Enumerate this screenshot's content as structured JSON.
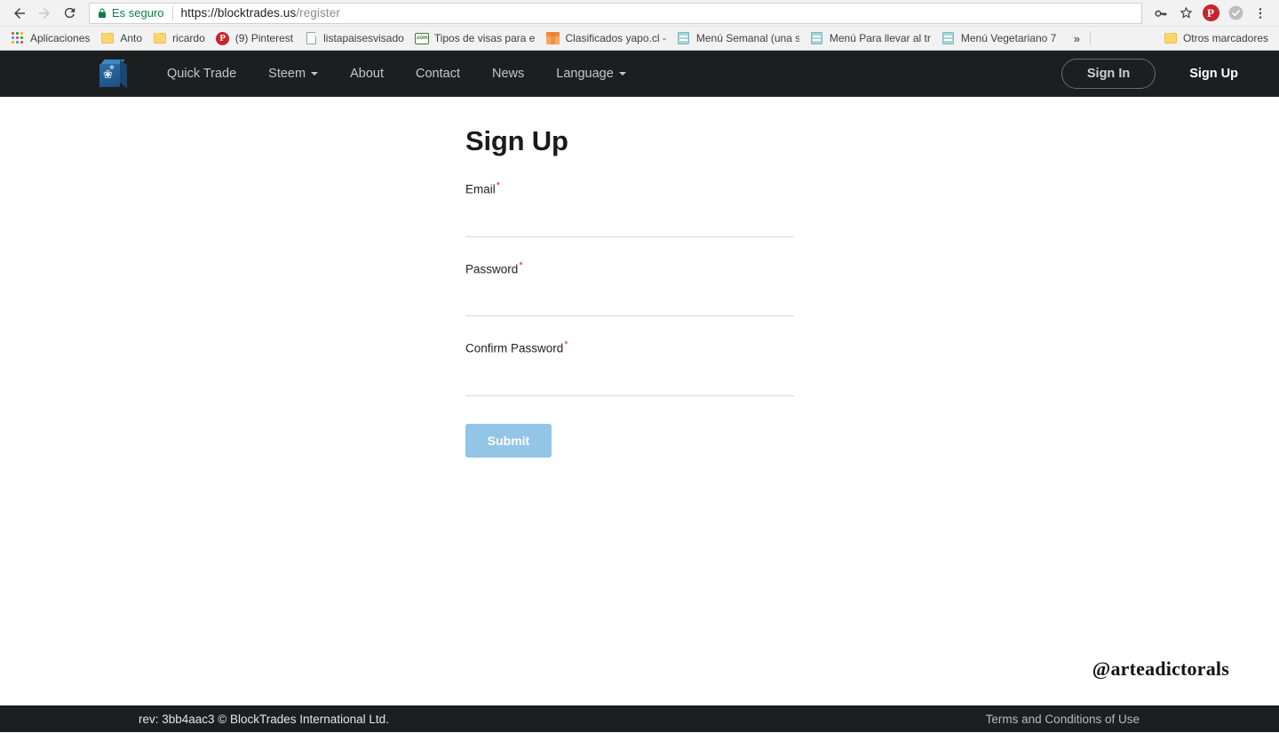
{
  "browser": {
    "back_icon": "back-arrow-icon",
    "forward_icon": "forward-arrow-icon",
    "reload_icon": "reload-icon",
    "security_label": "Es seguro",
    "url_origin": "https://blocktrades.us",
    "url_path": "/register",
    "url_full": "https://blocktrades.us/register",
    "toolbar_icons": [
      "key-icon",
      "star-icon",
      "pinterest-icon",
      "check-circle-icon",
      "three-dot-menu-icon"
    ],
    "bookmarks": [
      {
        "label": "Aplicaciones",
        "icon": "apps-grid-icon"
      },
      {
        "label": "Anto",
        "icon": "folder-icon"
      },
      {
        "label": "ricardo",
        "icon": "folder-icon"
      },
      {
        "label": "(9) Pinterest",
        "icon": "pinterest-icon"
      },
      {
        "label": "listapaisesvisado",
        "icon": "document-icon"
      },
      {
        "label": "Tipos de visas para e",
        "icon": "com-icon"
      },
      {
        "label": "Clasificados yapo.cl -",
        "icon": "box-icon"
      },
      {
        "label": "Menú Semanal (una s",
        "icon": "spreadsheet-icon"
      },
      {
        "label": "Menú Para llevar al tr",
        "icon": "spreadsheet-icon"
      },
      {
        "label": "Menú Vegetariano 7",
        "icon": "spreadsheet-icon"
      }
    ],
    "overflow_label": "»",
    "other_bookmarks": {
      "label": "Otros marcadores",
      "icon": "folder-icon"
    }
  },
  "site_nav": {
    "logo": "blocktrades-cube-logo",
    "links": [
      {
        "label": "Quick Trade",
        "has_caret": false
      },
      {
        "label": "Steem",
        "has_caret": true
      },
      {
        "label": "About",
        "has_caret": false
      },
      {
        "label": "Contact",
        "has_caret": false
      },
      {
        "label": "News",
        "has_caret": false
      },
      {
        "label": "Language",
        "has_caret": true
      }
    ],
    "sign_in_label": "Sign In",
    "sign_up_label": "Sign Up"
  },
  "form": {
    "title": "Sign Up",
    "required_marker": "*",
    "fields": [
      {
        "label": "Email",
        "value": "",
        "placeholder": "",
        "required": true,
        "type": "email"
      },
      {
        "label": "Password",
        "value": "",
        "placeholder": "",
        "required": true,
        "type": "password"
      },
      {
        "label": "Confirm Password",
        "value": "",
        "placeholder": "",
        "required": true,
        "type": "password"
      }
    ],
    "submit_label": "Submit",
    "submit_color": "#92c5e6"
  },
  "watermark": "@arteadictorals",
  "footer": {
    "revision": "rev: 3bb4aac3 © BlockTrades International Ltd.",
    "terms_label": "Terms and Conditions of Use",
    "background": "#1d1e20"
  }
}
